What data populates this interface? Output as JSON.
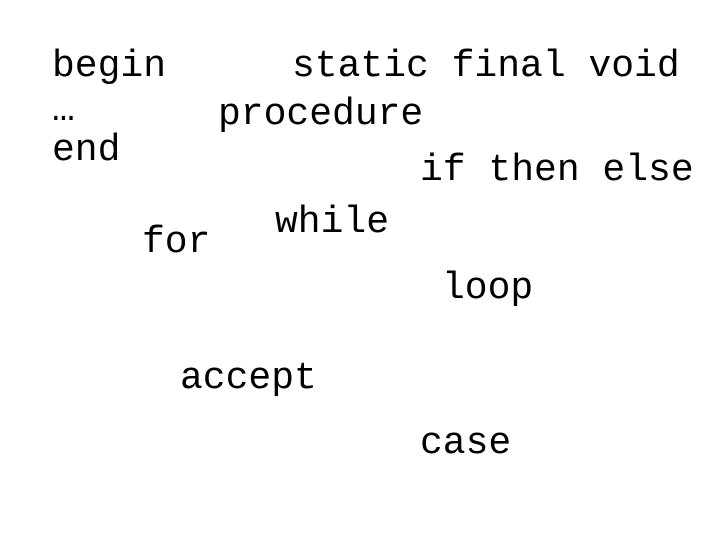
{
  "words": {
    "begin": "begin",
    "ellipsis": "…",
    "end": "end",
    "static_final_void": "static final void",
    "procedure": "procedure",
    "if_then_else": "if then else",
    "for": "for",
    "while": "while",
    "loop": "loop",
    "accept": "accept",
    "case": "case"
  }
}
